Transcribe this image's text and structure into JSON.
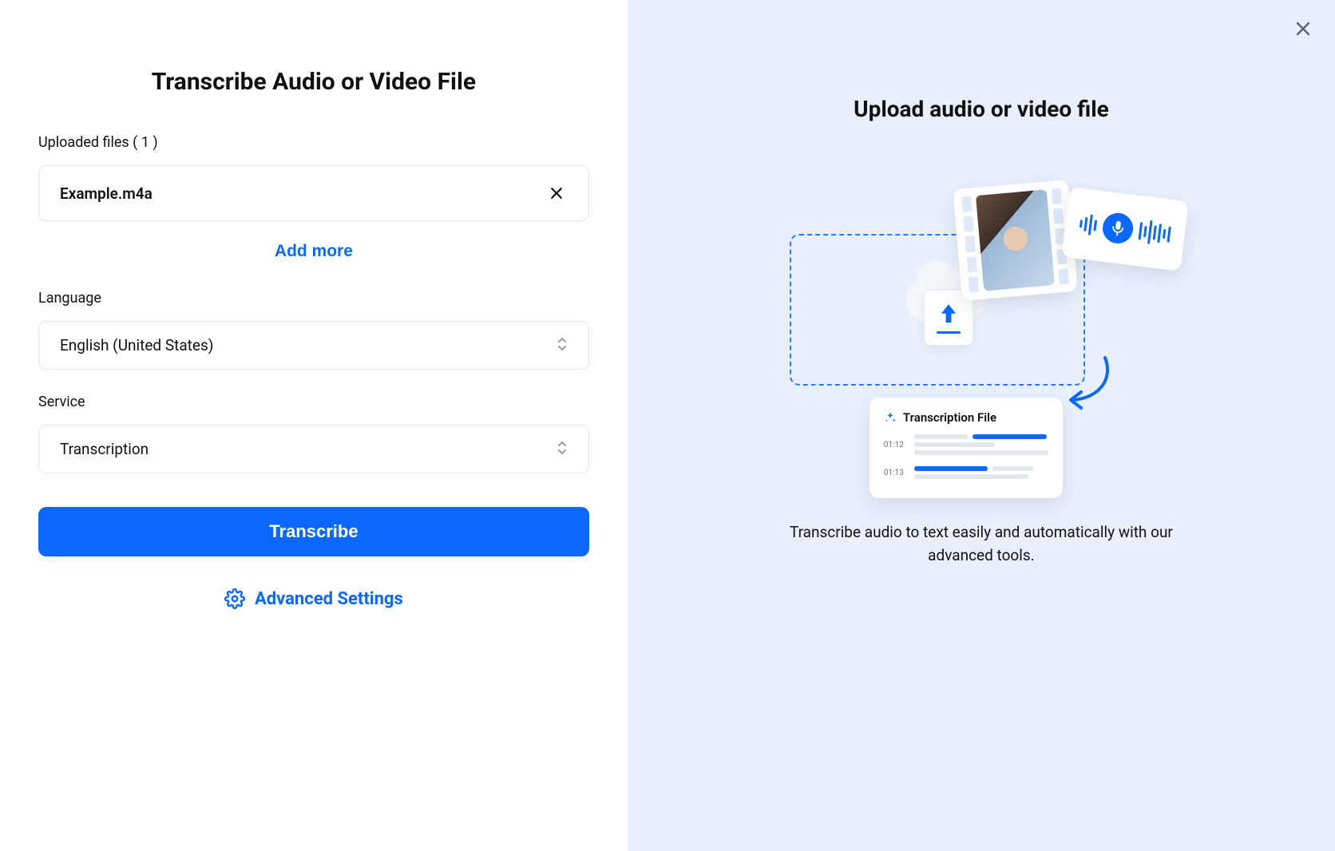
{
  "left": {
    "title": "Transcribe Audio or Video File",
    "uploaded_label_prefix": "Uploaded files",
    "uploaded_count": "1",
    "file_name": "Example.m4a",
    "add_more_label": "Add more",
    "language_label": "Language",
    "language_value": "English (United States)",
    "service_label": "Service",
    "service_value": "Transcription",
    "transcribe_button": "Transcribe",
    "advanced_settings": "Advanced Settings"
  },
  "right": {
    "title": "Upload audio or video file",
    "description": "Transcribe audio to text easily and automatically with our advanced tools.",
    "illustration": {
      "transcription_card_title": "Transcription File",
      "time1": "01:12",
      "time2": "01:13"
    }
  }
}
